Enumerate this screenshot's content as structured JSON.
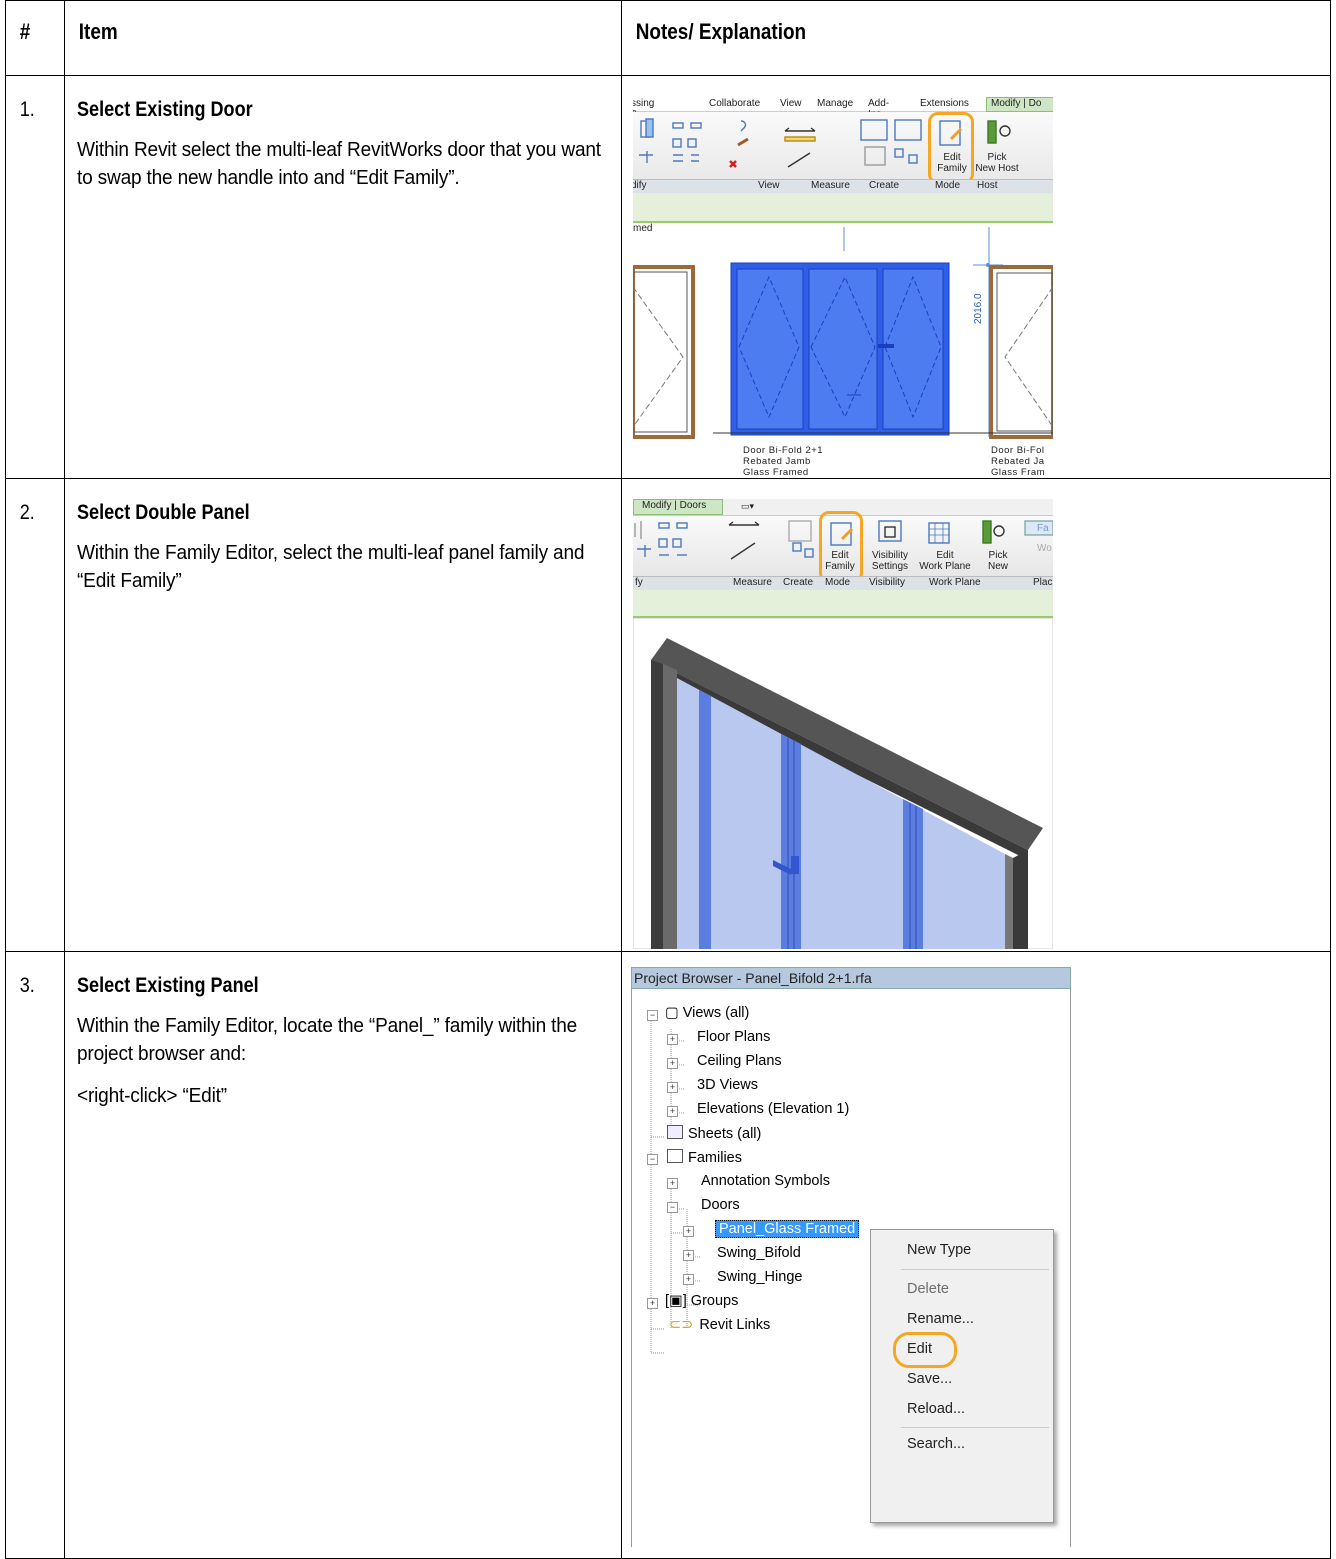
{
  "headers": {
    "num": "#",
    "item": "Item",
    "notes": "Notes/ Explanation"
  },
  "steps": [
    {
      "num": "1.",
      "title": "Select Existing Door",
      "body": "Within Revit select the multi-leaf RevitWorks door that you want to swap the new handle into and “Edit Family”."
    },
    {
      "num": "2.",
      "title": "Select Double Panel",
      "body": "Within the Family Editor, select the multi-leaf panel family and “Edit Family”"
    },
    {
      "num": "3.",
      "title": "Select Existing Panel",
      "body": "Within the Family Editor, locate the “Panel_” family within the project browser and:",
      "body2": "<right-click> “Edit”"
    }
  ],
  "shot1": {
    "tabs": [
      "ssing & Site",
      "Collaborate",
      "View",
      "Manage",
      "Add-Ins",
      "Extensions",
      "Modify | Do"
    ],
    "edit_family": [
      "Edit",
      "Family"
    ],
    "pick_new_host": [
      "Pick",
      "New Host"
    ],
    "panels": [
      "dify",
      "View",
      "Measure",
      "Create",
      "Mode",
      "Host"
    ],
    "view_text": "med",
    "dimension": "2016.0",
    "label1": [
      "Door Bi-Fold 2+1",
      "Rebated Jamb",
      "Glass Framed"
    ],
    "label2": [
      "Door Bi-Fol",
      "Rebated Ja",
      "Glass Fram"
    ]
  },
  "shot2": {
    "tab": "Modify | Doors",
    "tools": [
      [
        "Edit",
        "Family"
      ],
      [
        "Visibility",
        "Settings"
      ],
      [
        "Edit",
        "Work Plane"
      ],
      [
        "Pick",
        "New"
      ]
    ],
    "panels": [
      "fy",
      "Measure",
      "Create",
      "Mode",
      "Visibility",
      "Work Plane",
      "Plac"
    ],
    "side": [
      "Fa",
      "Wo"
    ]
  },
  "shot3": {
    "title": "Project Browser - Panel_Bifold 2+1.rfa",
    "tree": [
      "Views (all)",
      "Floor Plans",
      "Ceiling Plans",
      "3D Views",
      "Elevations (Elevation 1)",
      "Sheets (all)",
      "Families",
      "Annotation Symbols",
      "Doors",
      "Panel_Glass Framed",
      "Swing_Bifold",
      "Swing_Hinge",
      "Groups",
      "Revit Links"
    ],
    "menu": [
      "New Type",
      "Delete",
      "Rename...",
      "Edit",
      "Save...",
      "Reload...",
      "Search..."
    ]
  }
}
